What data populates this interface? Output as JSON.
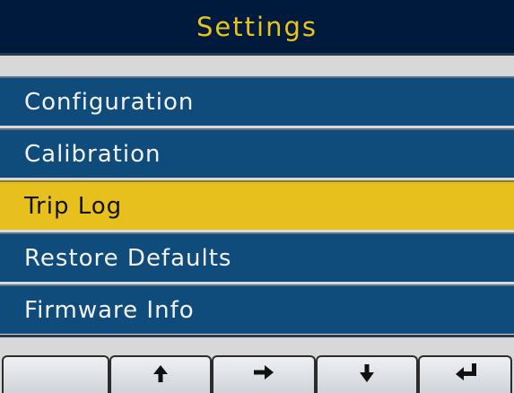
{
  "header": {
    "title": "Settings",
    "title_color": "#e9c41b",
    "background": "#001a3e"
  },
  "menu": {
    "items": [
      {
        "label": "Configuration",
        "selected": false
      },
      {
        "label": "Calibration",
        "selected": false
      },
      {
        "label": "Trip Log",
        "selected": true
      },
      {
        "label": "Restore Defaults",
        "selected": false
      },
      {
        "label": "Firmware Info",
        "selected": false
      }
    ],
    "item_color": "#0f4c7c",
    "selected_color": "#e7c01e"
  },
  "softkeys": [
    {
      "icon": "blank"
    },
    {
      "icon": "arrow-up-icon"
    },
    {
      "icon": "arrow-right-icon"
    },
    {
      "icon": "arrow-down-icon"
    },
    {
      "icon": "enter-arrow-icon"
    }
  ]
}
